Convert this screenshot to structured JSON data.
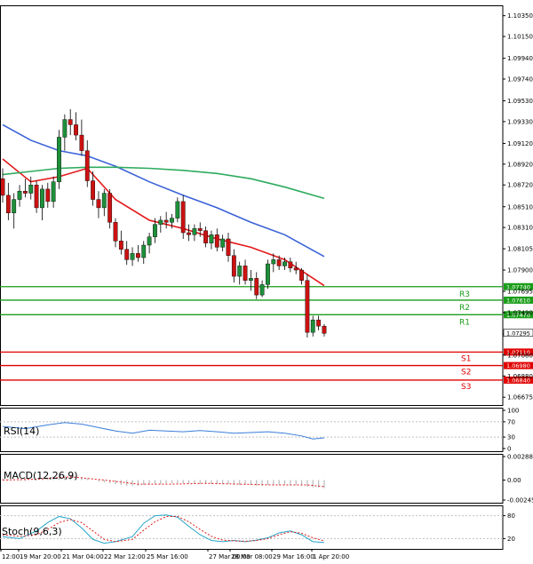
{
  "chart_data": {
    "type": "candlestick",
    "instrument_price_axis": {
      "ticks": [
        "1.10350",
        "1.10150",
        "1.09940",
        "1.09740",
        "1.09530",
        "1.09330",
        "1.09120",
        "1.08920",
        "1.08720",
        "1.08510",
        "1.08310",
        "1.08105",
        "1.07900",
        "1.07695",
        "1.07490",
        "1.07285",
        "1.07080",
        "1.06880",
        "1.06675"
      ],
      "ylim": [
        1.066,
        1.1045
      ]
    },
    "time_axis": {
      "labels": [
        "12:00",
        "19 Mar 20:00",
        "21 Mar 04:00",
        "22 Mar 12:00",
        "25 Mar 16:00",
        "27 Mar 00:00",
        "28 Mar 08:00",
        "29 Mar 16:00",
        "1 Apr 20:00"
      ]
    },
    "current_price": "1.07295",
    "levels": [
      {
        "name": "R3",
        "value": 1.0774,
        "tag": "1.07740",
        "color": "#1a9e1a"
      },
      {
        "name": "R2",
        "value": 1.0761,
        "tag": "1.07610",
        "color": "#1a9e1a"
      },
      {
        "name": "R1",
        "value": 1.0747,
        "tag": "1.07470",
        "color": "#1a9e1a"
      },
      {
        "name": "S1",
        "value": 1.0711,
        "tag": "1.07110",
        "color": "#e00000"
      },
      {
        "name": "S2",
        "value": 1.0698,
        "tag": "1.06980",
        "color": "#e00000"
      },
      {
        "name": "S3",
        "value": 1.0684,
        "tag": "1.06840",
        "color": "#e00000"
      }
    ],
    "candles": [
      [
        1.0878,
        1.0888,
        1.0855,
        1.0862
      ],
      [
        1.0862,
        1.0874,
        1.0838,
        1.0845
      ],
      [
        1.0845,
        1.0864,
        1.083,
        1.0858
      ],
      [
        1.0858,
        1.0872,
        1.0851,
        1.0866
      ],
      [
        1.0866,
        1.0878,
        1.086,
        1.0864
      ],
      [
        1.0864,
        1.088,
        1.0858,
        1.0872
      ],
      [
        1.0872,
        1.0876,
        1.0845,
        1.085
      ],
      [
        1.085,
        1.0872,
        1.0838,
        1.0868
      ],
      [
        1.0868,
        1.0874,
        1.085,
        1.0856
      ],
      [
        1.0856,
        1.088,
        1.085,
        1.0875
      ],
      [
        1.0875,
        1.0925,
        1.0868,
        1.0918
      ],
      [
        1.0918,
        1.094,
        1.0905,
        1.0935
      ],
      [
        1.0935,
        1.0945,
        1.092,
        1.093
      ],
      [
        1.093,
        1.0942,
        1.0915,
        1.092
      ],
      [
        1.092,
        1.0935,
        1.09,
        1.0905
      ],
      [
        1.0905,
        1.0915,
        1.087,
        1.0876
      ],
      [
        1.0876,
        1.0885,
        1.0852,
        1.0858
      ],
      [
        1.0858,
        1.0866,
        1.084,
        1.085
      ],
      [
        1.085,
        1.0868,
        1.0842,
        1.0864
      ],
      [
        1.0864,
        1.0868,
        1.083,
        1.0836
      ],
      [
        1.0836,
        1.084,
        1.0812,
        1.0818
      ],
      [
        1.0818,
        1.0828,
        1.0805,
        1.081
      ],
      [
        1.081,
        1.0818,
        1.0795,
        1.08
      ],
      [
        1.08,
        1.0812,
        1.0794,
        1.0806
      ],
      [
        1.0806,
        1.0814,
        1.0798,
        1.0802
      ],
      [
        1.0802,
        1.0818,
        1.0796,
        1.0814
      ],
      [
        1.0814,
        1.0826,
        1.0806,
        1.0822
      ],
      [
        1.0822,
        1.084,
        1.0816,
        1.0834
      ],
      [
        1.0834,
        1.0842,
        1.0826,
        1.0838
      ],
      [
        1.0838,
        1.0846,
        1.083,
        1.0836
      ],
      [
        1.0836,
        1.0844,
        1.083,
        1.084
      ],
      [
        1.084,
        1.086,
        1.0836,
        1.0856
      ],
      [
        1.0856,
        1.0862,
        1.082,
        1.0826
      ],
      [
        1.0826,
        1.0834,
        1.0818,
        1.0824
      ],
      [
        1.0824,
        1.0834,
        1.0818,
        1.083
      ],
      [
        1.083,
        1.0836,
        1.0822,
        1.0828
      ],
      [
        1.0828,
        1.0832,
        1.0812,
        1.0816
      ],
      [
        1.0816,
        1.0828,
        1.081,
        1.0824
      ],
      [
        1.0824,
        1.083,
        1.0808,
        1.0812
      ],
      [
        1.0812,
        1.0824,
        1.0808,
        1.082
      ],
      [
        1.082,
        1.0826,
        1.0798,
        1.0804
      ],
      [
        1.0804,
        1.081,
        1.0778,
        1.0784
      ],
      [
        1.0784,
        1.0798,
        1.0776,
        1.0794
      ],
      [
        1.0794,
        1.08,
        1.0776,
        1.078
      ],
      [
        1.078,
        1.079,
        1.077,
        1.0782
      ],
      [
        1.0782,
        1.0788,
        1.0762,
        1.0766
      ],
      [
        1.0766,
        1.078,
        1.0764,
        1.0776
      ],
      [
        1.0776,
        1.08,
        1.0772,
        1.0796
      ],
      [
        1.0796,
        1.0806,
        1.0788,
        1.08
      ],
      [
        1.08,
        1.0804,
        1.079,
        1.0794
      ],
      [
        1.0794,
        1.0802,
        1.079,
        1.0798
      ],
      [
        1.0798,
        1.0802,
        1.0788,
        1.0792
      ],
      [
        1.0792,
        1.0798,
        1.0786,
        1.079
      ],
      [
        1.079,
        1.0792,
        1.0776,
        1.078
      ],
      [
        1.078,
        1.0786,
        1.0725,
        1.073
      ],
      [
        1.073,
        1.0746,
        1.0726,
        1.0742
      ],
      [
        1.0742,
        1.0746,
        1.0732,
        1.0736
      ],
      [
        1.0736,
        1.0738,
        1.0726,
        1.0729
      ]
    ],
    "moving_averages": [
      {
        "color": "#e31a1c",
        "values": [
          [
            0,
            1.0897
          ],
          [
            5,
            1.0875
          ],
          [
            10,
            1.088
          ],
          [
            15,
            1.0888
          ],
          [
            20,
            1.0858
          ],
          [
            26,
            1.0838
          ],
          [
            32,
            1.083
          ],
          [
            38,
            1.082
          ],
          [
            44,
            1.0812
          ],
          [
            50,
            1.08
          ],
          [
            57,
            1.0775
          ]
        ]
      },
      {
        "color": "#3a62d8",
        "values": [
          [
            0,
            1.093
          ],
          [
            5,
            1.0915
          ],
          [
            10,
            1.0905
          ],
          [
            15,
            1.09
          ],
          [
            20,
            1.089
          ],
          [
            26,
            1.0875
          ],
          [
            32,
            1.0862
          ],
          [
            38,
            1.085
          ],
          [
            44,
            1.0836
          ],
          [
            50,
            1.0824
          ],
          [
            57,
            1.0803
          ]
        ]
      },
      {
        "color": "#2eab5d",
        "values": [
          [
            0,
            1.0882
          ],
          [
            5,
            1.0885
          ],
          [
            10,
            1.0888
          ],
          [
            15,
            1.0889
          ],
          [
            20,
            1.0889
          ],
          [
            26,
            1.0888
          ],
          [
            32,
            1.0886
          ],
          [
            38,
            1.0883
          ],
          [
            44,
            1.0878
          ],
          [
            50,
            1.087
          ],
          [
            57,
            1.0859
          ]
        ]
      }
    ],
    "rsi": {
      "label": "RSI(14)",
      "ticks": [
        "100",
        "70",
        "30",
        "0"
      ],
      "ylim": [
        0,
        100
      ],
      "values": [
        [
          0,
          58
        ],
        [
          4,
          52
        ],
        [
          8,
          62
        ],
        [
          11,
          68
        ],
        [
          14,
          64
        ],
        [
          17,
          55
        ],
        [
          20,
          46
        ],
        [
          23,
          40
        ],
        [
          26,
          48
        ],
        [
          29,
          46
        ],
        [
          32,
          44
        ],
        [
          35,
          47
        ],
        [
          38,
          44
        ],
        [
          41,
          40
        ],
        [
          44,
          42
        ],
        [
          47,
          44
        ],
        [
          50,
          40
        ],
        [
          53,
          33
        ],
        [
          55,
          25
        ],
        [
          57,
          28
        ]
      ],
      "line_color": "#3a7ed8"
    },
    "macd": {
      "label": "MACD(12,26,9)",
      "ticks": [
        "0.002882",
        "0.00",
        "-0.00245"
      ],
      "ylim": [
        -0.00245,
        0.002882
      ],
      "histogram": [
        0.0002,
        0.0001,
        0.0,
        -0.0001,
        -0.0001,
        0.0,
        0.0001,
        0.0002,
        0.0003,
        0.0004,
        0.0005,
        0.0006,
        0.0006,
        0.0005,
        0.0004,
        0.0002,
        0.0,
        -0.0002,
        -0.0003,
        -0.0004,
        -0.0005,
        -0.0006,
        -0.0007,
        -0.0007,
        -0.0007,
        -0.0006,
        -0.0006,
        -0.0005,
        -0.0005,
        -0.0004,
        -0.0004,
        -0.0004,
        -0.0004,
        -0.0004,
        -0.0005,
        -0.0005,
        -0.0005,
        -0.0005,
        -0.0005,
        -0.0005,
        -0.0005,
        -0.0006,
        -0.0006,
        -0.0006,
        -0.0006,
        -0.0007,
        -0.0007,
        -0.0006,
        -0.0006,
        -0.0006,
        -0.0006,
        -0.0006,
        -0.0006,
        -0.0006,
        -0.0008,
        -0.0009,
        -0.0009,
        -0.001
      ],
      "signal": [
        [
          0,
          0.0
        ],
        [
          6,
          0.0001
        ],
        [
          12,
          0.0004
        ],
        [
          18,
          0.0
        ],
        [
          24,
          -0.0005
        ],
        [
          30,
          -0.0005
        ],
        [
          36,
          -0.0004
        ],
        [
          42,
          -0.0005
        ],
        [
          48,
          -0.0006
        ],
        [
          54,
          -0.0006
        ],
        [
          57,
          -0.0008
        ]
      ],
      "signal_color": "#e31a1c",
      "bar_color": "#b8b8b8"
    },
    "stoch": {
      "label": "Stoch(9,6,3)",
      "ticks": [
        "80",
        "20"
      ],
      "ylim": [
        0,
        100
      ],
      "main": [
        [
          0,
          25
        ],
        [
          3,
          20
        ],
        [
          6,
          40
        ],
        [
          8,
          62
        ],
        [
          10,
          78
        ],
        [
          12,
          72
        ],
        [
          14,
          48
        ],
        [
          16,
          18
        ],
        [
          18,
          8
        ],
        [
          20,
          12
        ],
        [
          23,
          25
        ],
        [
          25,
          60
        ],
        [
          27,
          80
        ],
        [
          29,
          82
        ],
        [
          31,
          76
        ],
        [
          33,
          52
        ],
        [
          35,
          30
        ],
        [
          37,
          15
        ],
        [
          39,
          12
        ],
        [
          41,
          15
        ],
        [
          43,
          12
        ],
        [
          45,
          16
        ],
        [
          47,
          22
        ],
        [
          49,
          35
        ],
        [
          51,
          40
        ],
        [
          53,
          30
        ],
        [
          55,
          12
        ],
        [
          57,
          10
        ]
      ],
      "signal": [
        [
          0,
          30
        ],
        [
          3,
          26
        ],
        [
          6,
          30
        ],
        [
          8,
          44
        ],
        [
          10,
          62
        ],
        [
          12,
          70
        ],
        [
          14,
          62
        ],
        [
          16,
          40
        ],
        [
          18,
          18
        ],
        [
          20,
          12
        ],
        [
          23,
          18
        ],
        [
          25,
          42
        ],
        [
          27,
          64
        ],
        [
          29,
          78
        ],
        [
          31,
          78
        ],
        [
          33,
          64
        ],
        [
          35,
          44
        ],
        [
          37,
          26
        ],
        [
          39,
          16
        ],
        [
          41,
          14
        ],
        [
          43,
          13
        ],
        [
          45,
          15
        ],
        [
          47,
          20
        ],
        [
          49,
          30
        ],
        [
          51,
          38
        ],
        [
          53,
          34
        ],
        [
          55,
          22
        ],
        [
          57,
          14
        ]
      ],
      "main_color": "#26a5c8",
      "signal_color": "#e31a1c"
    }
  }
}
